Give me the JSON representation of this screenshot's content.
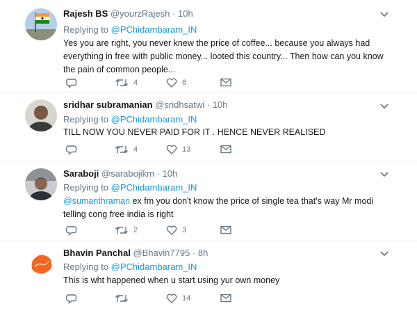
{
  "tweets": [
    {
      "name": "Rajesh BS",
      "handle": "@yourzRajesh",
      "dot": "·",
      "time": "10h",
      "replying_prefix": "Replying to",
      "replying_to": "@PChidambaram_IN",
      "text_mention": "",
      "text": "Yes you are right, you never knew the price of coffee... because you always had everything in free with public money... looted this country... Then how can you know the pain of common people...",
      "retweets": "4",
      "likes": "6"
    },
    {
      "name": "sridhar subramanian",
      "handle": "@sridhsatwi",
      "dot": "·",
      "time": "10h",
      "replying_prefix": "Replying to",
      "replying_to": "@PChidambaram_IN",
      "text_mention": "",
      "text": "TILL NOW YOU NEVER PAID FOR IT . HENCE NEVER REALISED",
      "retweets": "4",
      "likes": "13"
    },
    {
      "name": "Saraboji",
      "handle": "@sarabojikm",
      "dot": "·",
      "time": "10h",
      "replying_prefix": "Replying to",
      "replying_to": "@PChidambaram_IN",
      "text_mention": "@sumanthraman",
      "text": " ex fm you don't know the price of single tea that's way Mr modi telling cong free india is right",
      "retweets": "2",
      "likes": "3"
    },
    {
      "name": "Bhavin Panchal",
      "handle": "@Bhavin7795",
      "dot": "·",
      "time": "8h",
      "replying_prefix": "Replying to",
      "replying_to": "@PChidambaram_IN",
      "text_mention": "",
      "text": "This is wht happened when u start using yur own money",
      "retweets": "",
      "likes": "14"
    }
  ],
  "icons": {
    "reply": "reply-icon",
    "retweet": "retweet-icon",
    "like": "heart-icon",
    "dm": "envelope-icon",
    "menu": "chevron-down-icon"
  },
  "colors": {
    "link": "#1b95e0",
    "muted": "#657786",
    "text": "#14171a",
    "divider": "#e6ecf0"
  }
}
